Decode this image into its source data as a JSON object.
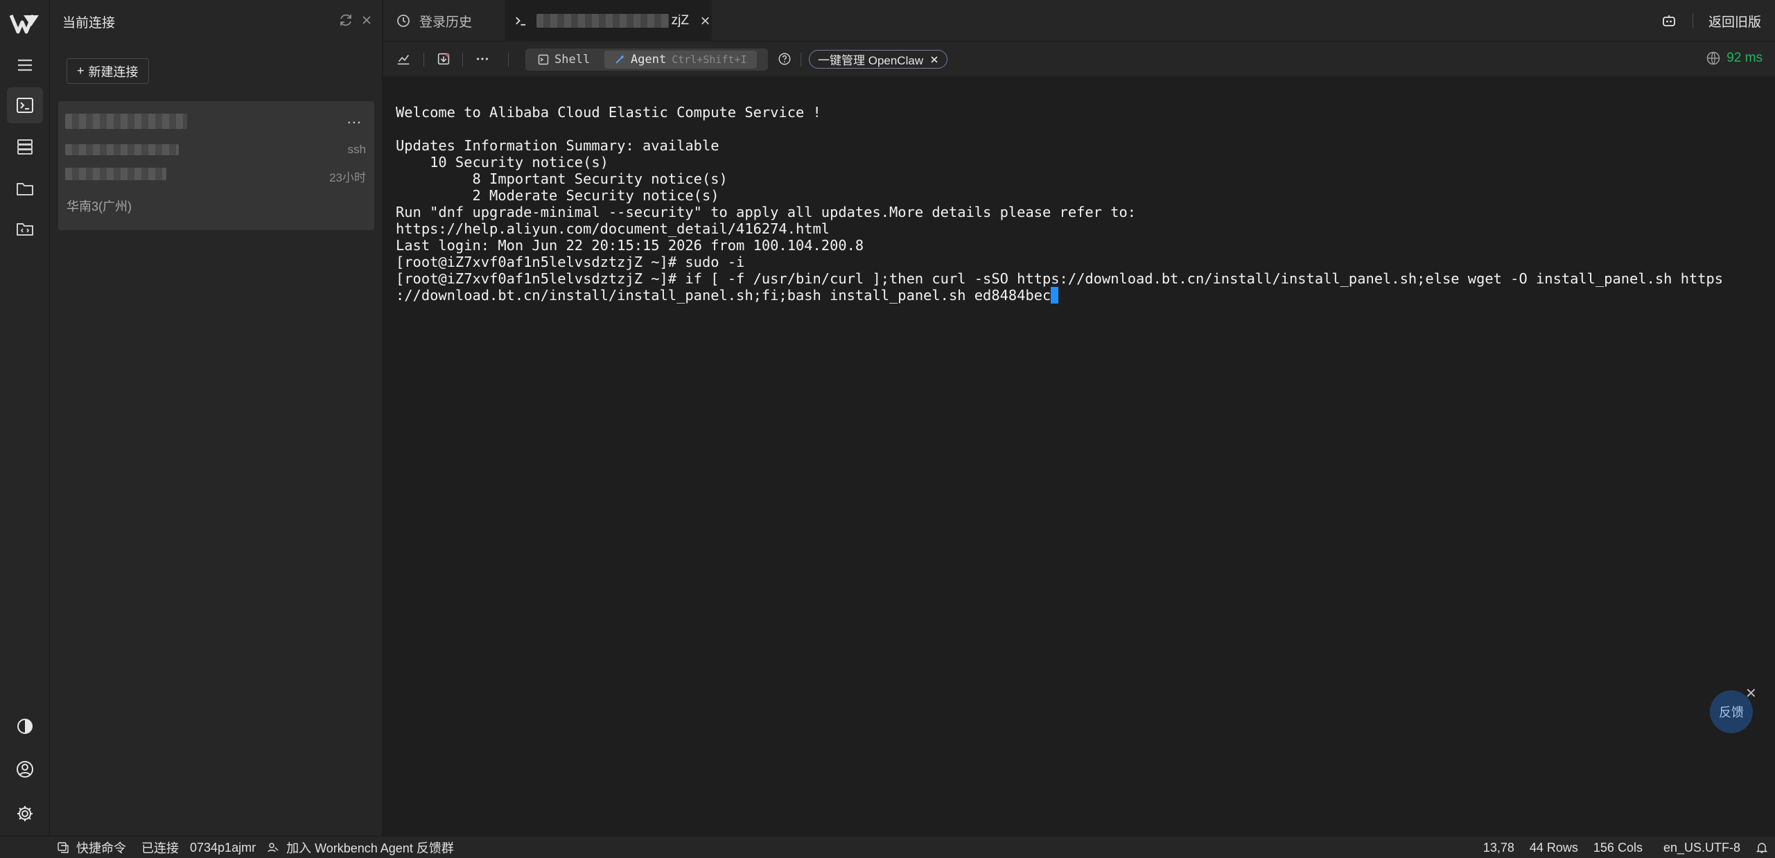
{
  "panel": {
    "title": "当前连接",
    "new_connection_label": "新建连接",
    "session": {
      "more": "...",
      "protocol": "ssh",
      "age": "23小时",
      "region": "华南3(广州)"
    }
  },
  "tabs": [
    {
      "label": "登录历史",
      "icon": "history-icon"
    },
    {
      "label": "zjZ",
      "icon": "terminal-icon",
      "active": true
    }
  ],
  "topbar": {
    "back_label": "返回旧版",
    "bot_icon": "robot-icon"
  },
  "toolbar": {
    "shell_label": "Shell",
    "agent_label": "Agent",
    "agent_shortcut": "Ctrl+Shift+I",
    "pill_label": "一键管理 OpenClaw",
    "latency": "92 ms"
  },
  "terminal": {
    "lines": [
      "Welcome to Alibaba Cloud Elastic Compute Service !",
      "",
      "Updates Information Summary: available",
      "    10 Security notice(s)",
      "         8 Important Security notice(s)",
      "         2 Moderate Security notice(s)",
      "Run \"dnf upgrade-minimal --security\" to apply all updates.More details please refer to:",
      "https://help.aliyun.com/document_detail/416274.html",
      "Last login: Mon Jun 22 20:15:15 2026 from 100.104.200.8",
      "[root@iZ7xvf0af1n5lelvsdztzjZ ~]# sudo -i",
      "[root@iZ7xvf0af1n5lelvsdztzjZ ~]# if [ -f /usr/bin/curl ];then curl -sSO https://download.bt.cn/install/install_panel.sh;else wget -O install_panel.sh https",
      "://download.bt.cn/install/install_panel.sh;fi;bash install_panel.sh ed8484bec"
    ]
  },
  "feedback_label": "反馈",
  "statusbar": {
    "quick_commands": "快捷命令",
    "connected": "已连接",
    "session_id": "0734p1ajmr",
    "join_group": "加入 Workbench Agent 反馈群",
    "cursor_pos": "13,78",
    "rows": "44 Rows",
    "cols": "156 Cols",
    "encoding": "en_US.UTF-8"
  },
  "colors": {
    "accent": "#1e90ff",
    "latency_green": "#22b35e",
    "background": "#1e1e1e",
    "panel": "#262626"
  }
}
